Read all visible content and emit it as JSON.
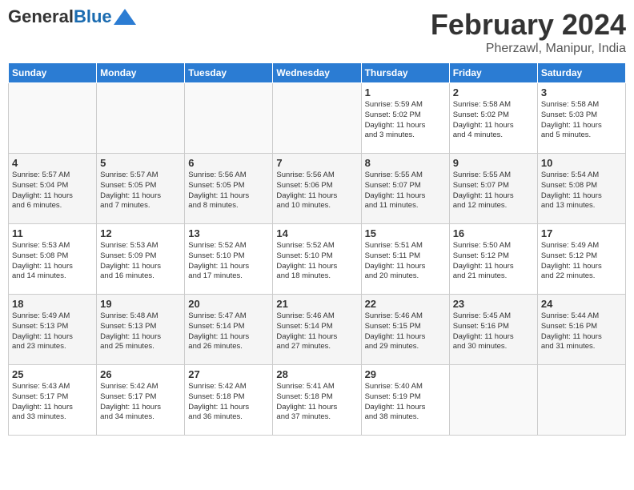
{
  "header": {
    "logo_line1": "General",
    "logo_line2": "Blue",
    "title": "February 2024",
    "location": "Pherzawl, Manipur, India"
  },
  "days_of_week": [
    "Sunday",
    "Monday",
    "Tuesday",
    "Wednesday",
    "Thursday",
    "Friday",
    "Saturday"
  ],
  "weeks": [
    [
      {
        "day": "",
        "info": ""
      },
      {
        "day": "",
        "info": ""
      },
      {
        "day": "",
        "info": ""
      },
      {
        "day": "",
        "info": ""
      },
      {
        "day": "1",
        "info": "Sunrise: 5:59 AM\nSunset: 5:02 PM\nDaylight: 11 hours\nand 3 minutes."
      },
      {
        "day": "2",
        "info": "Sunrise: 5:58 AM\nSunset: 5:02 PM\nDaylight: 11 hours\nand 4 minutes."
      },
      {
        "day": "3",
        "info": "Sunrise: 5:58 AM\nSunset: 5:03 PM\nDaylight: 11 hours\nand 5 minutes."
      }
    ],
    [
      {
        "day": "4",
        "info": "Sunrise: 5:57 AM\nSunset: 5:04 PM\nDaylight: 11 hours\nand 6 minutes."
      },
      {
        "day": "5",
        "info": "Sunrise: 5:57 AM\nSunset: 5:05 PM\nDaylight: 11 hours\nand 7 minutes."
      },
      {
        "day": "6",
        "info": "Sunrise: 5:56 AM\nSunset: 5:05 PM\nDaylight: 11 hours\nand 8 minutes."
      },
      {
        "day": "7",
        "info": "Sunrise: 5:56 AM\nSunset: 5:06 PM\nDaylight: 11 hours\nand 10 minutes."
      },
      {
        "day": "8",
        "info": "Sunrise: 5:55 AM\nSunset: 5:07 PM\nDaylight: 11 hours\nand 11 minutes."
      },
      {
        "day": "9",
        "info": "Sunrise: 5:55 AM\nSunset: 5:07 PM\nDaylight: 11 hours\nand 12 minutes."
      },
      {
        "day": "10",
        "info": "Sunrise: 5:54 AM\nSunset: 5:08 PM\nDaylight: 11 hours\nand 13 minutes."
      }
    ],
    [
      {
        "day": "11",
        "info": "Sunrise: 5:53 AM\nSunset: 5:08 PM\nDaylight: 11 hours\nand 14 minutes."
      },
      {
        "day": "12",
        "info": "Sunrise: 5:53 AM\nSunset: 5:09 PM\nDaylight: 11 hours\nand 16 minutes."
      },
      {
        "day": "13",
        "info": "Sunrise: 5:52 AM\nSunset: 5:10 PM\nDaylight: 11 hours\nand 17 minutes."
      },
      {
        "day": "14",
        "info": "Sunrise: 5:52 AM\nSunset: 5:10 PM\nDaylight: 11 hours\nand 18 minutes."
      },
      {
        "day": "15",
        "info": "Sunrise: 5:51 AM\nSunset: 5:11 PM\nDaylight: 11 hours\nand 20 minutes."
      },
      {
        "day": "16",
        "info": "Sunrise: 5:50 AM\nSunset: 5:12 PM\nDaylight: 11 hours\nand 21 minutes."
      },
      {
        "day": "17",
        "info": "Sunrise: 5:49 AM\nSunset: 5:12 PM\nDaylight: 11 hours\nand 22 minutes."
      }
    ],
    [
      {
        "day": "18",
        "info": "Sunrise: 5:49 AM\nSunset: 5:13 PM\nDaylight: 11 hours\nand 23 minutes."
      },
      {
        "day": "19",
        "info": "Sunrise: 5:48 AM\nSunset: 5:13 PM\nDaylight: 11 hours\nand 25 minutes."
      },
      {
        "day": "20",
        "info": "Sunrise: 5:47 AM\nSunset: 5:14 PM\nDaylight: 11 hours\nand 26 minutes."
      },
      {
        "day": "21",
        "info": "Sunrise: 5:46 AM\nSunset: 5:14 PM\nDaylight: 11 hours\nand 27 minutes."
      },
      {
        "day": "22",
        "info": "Sunrise: 5:46 AM\nSunset: 5:15 PM\nDaylight: 11 hours\nand 29 minutes."
      },
      {
        "day": "23",
        "info": "Sunrise: 5:45 AM\nSunset: 5:16 PM\nDaylight: 11 hours\nand 30 minutes."
      },
      {
        "day": "24",
        "info": "Sunrise: 5:44 AM\nSunset: 5:16 PM\nDaylight: 11 hours\nand 31 minutes."
      }
    ],
    [
      {
        "day": "25",
        "info": "Sunrise: 5:43 AM\nSunset: 5:17 PM\nDaylight: 11 hours\nand 33 minutes."
      },
      {
        "day": "26",
        "info": "Sunrise: 5:42 AM\nSunset: 5:17 PM\nDaylight: 11 hours\nand 34 minutes."
      },
      {
        "day": "27",
        "info": "Sunrise: 5:42 AM\nSunset: 5:18 PM\nDaylight: 11 hours\nand 36 minutes."
      },
      {
        "day": "28",
        "info": "Sunrise: 5:41 AM\nSunset: 5:18 PM\nDaylight: 11 hours\nand 37 minutes."
      },
      {
        "day": "29",
        "info": "Sunrise: 5:40 AM\nSunset: 5:19 PM\nDaylight: 11 hours\nand 38 minutes."
      },
      {
        "day": "",
        "info": ""
      },
      {
        "day": "",
        "info": ""
      }
    ]
  ]
}
